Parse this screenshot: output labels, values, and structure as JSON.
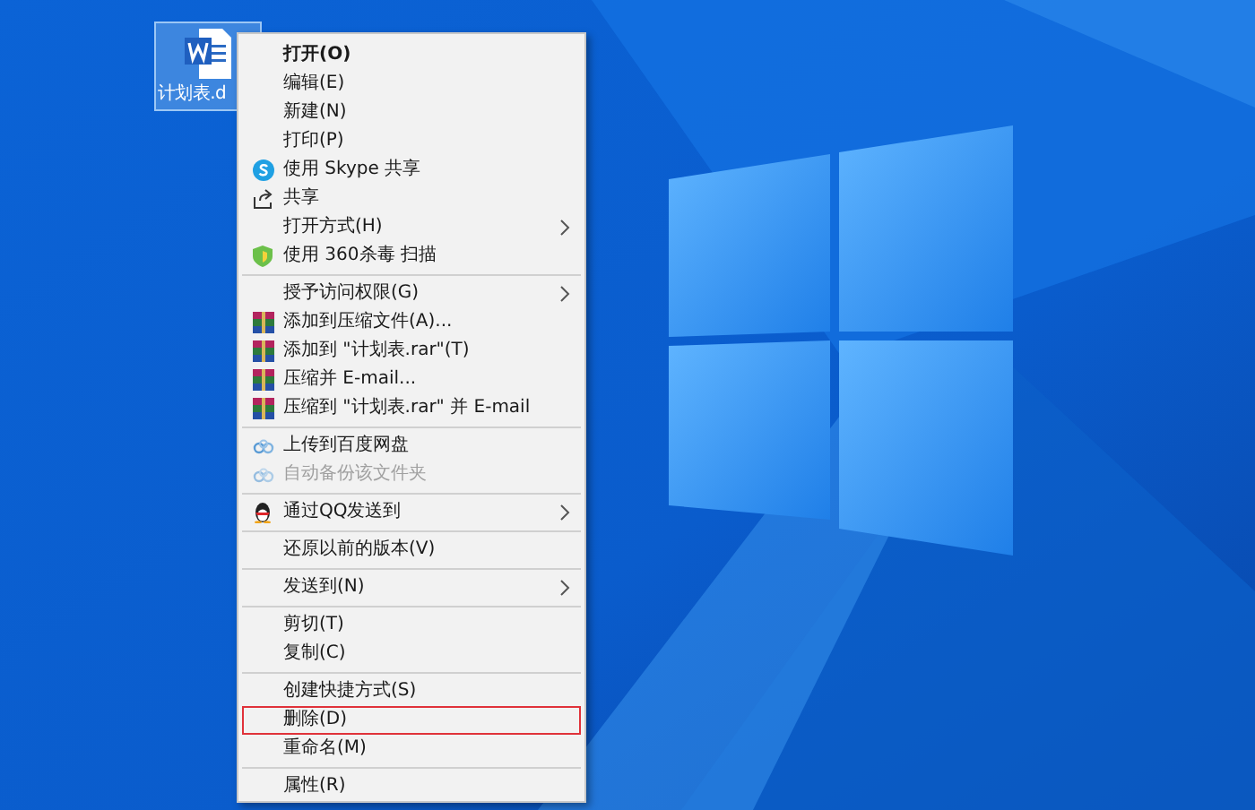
{
  "desktop_icon": {
    "label": "计划表.d",
    "selected": true
  },
  "context_menu": {
    "groups": [
      {
        "items": [
          {
            "label": "打开(O)",
            "default": true,
            "submenu": false,
            "disabled": false,
            "highlighted": false
          },
          {
            "label": "编辑(E)",
            "default": false,
            "submenu": false,
            "disabled": false,
            "highlighted": false
          },
          {
            "label": "新建(N)",
            "default": false,
            "submenu": false,
            "disabled": false,
            "highlighted": false
          },
          {
            "label": "打印(P)",
            "default": false,
            "submenu": false,
            "disabled": false,
            "highlighted": false
          },
          {
            "label": "使用 Skype 共享",
            "default": false,
            "submenu": false,
            "disabled": false,
            "highlighted": false
          },
          {
            "label": "共享",
            "default": false,
            "submenu": false,
            "disabled": false,
            "highlighted": false
          },
          {
            "label": "打开方式(H)",
            "default": false,
            "submenu": true,
            "disabled": false,
            "highlighted": false
          },
          {
            "label": "使用 360杀毒 扫描",
            "default": false,
            "submenu": false,
            "disabled": false,
            "highlighted": false
          }
        ]
      },
      {
        "items": [
          {
            "label": "授予访问权限(G)",
            "default": false,
            "submenu": true,
            "disabled": false,
            "highlighted": false
          },
          {
            "label": "添加到压缩文件(A)...",
            "default": false,
            "submenu": false,
            "disabled": false,
            "highlighted": false
          },
          {
            "label": "添加到 \"计划表.rar\"(T)",
            "default": false,
            "submenu": false,
            "disabled": false,
            "highlighted": false
          },
          {
            "label": "压缩并 E-mail...",
            "default": false,
            "submenu": false,
            "disabled": false,
            "highlighted": false
          },
          {
            "label": "压缩到 \"计划表.rar\" 并 E-mail",
            "default": false,
            "submenu": false,
            "disabled": false,
            "highlighted": false
          }
        ]
      },
      {
        "items": [
          {
            "label": "上传到百度网盘",
            "default": false,
            "submenu": false,
            "disabled": false,
            "highlighted": false
          },
          {
            "label": "自动备份该文件夹",
            "default": false,
            "submenu": false,
            "disabled": true,
            "highlighted": false
          }
        ]
      },
      {
        "items": [
          {
            "label": "通过QQ发送到",
            "default": false,
            "submenu": true,
            "disabled": false,
            "highlighted": false
          }
        ]
      },
      {
        "items": [
          {
            "label": "还原以前的版本(V)",
            "default": false,
            "submenu": false,
            "disabled": false,
            "highlighted": false
          }
        ]
      },
      {
        "items": [
          {
            "label": "发送到(N)",
            "default": false,
            "submenu": true,
            "disabled": false,
            "highlighted": false
          }
        ]
      },
      {
        "items": [
          {
            "label": "剪切(T)",
            "default": false,
            "submenu": false,
            "disabled": false,
            "highlighted": false
          },
          {
            "label": "复制(C)",
            "default": false,
            "submenu": false,
            "disabled": false,
            "highlighted": false
          }
        ]
      },
      {
        "items": [
          {
            "label": "创建快捷方式(S)",
            "default": false,
            "submenu": false,
            "disabled": false,
            "highlighted": false
          },
          {
            "label": "删除(D)",
            "default": false,
            "submenu": false,
            "disabled": false,
            "highlighted": true
          },
          {
            "label": "重命名(M)",
            "default": false,
            "submenu": false,
            "disabled": false,
            "highlighted": false
          }
        ]
      },
      {
        "items": [
          {
            "label": "属性(R)",
            "default": false,
            "submenu": false,
            "disabled": false,
            "highlighted": false
          }
        ]
      }
    ]
  }
}
